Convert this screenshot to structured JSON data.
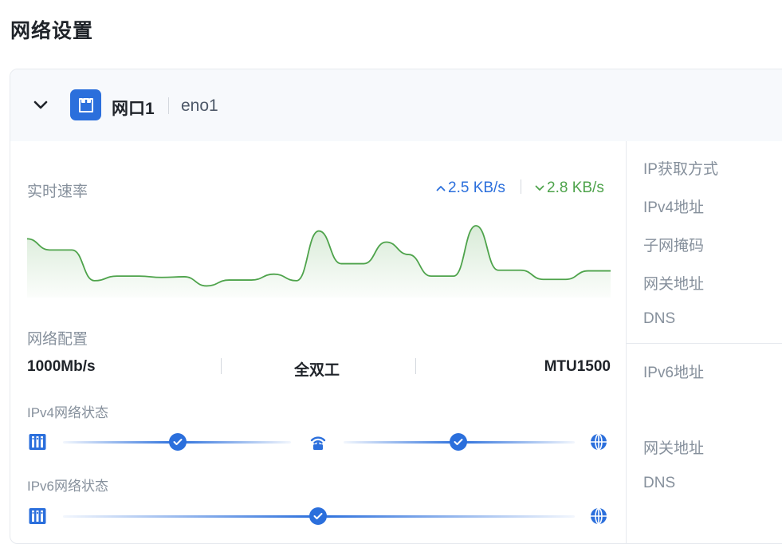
{
  "page": {
    "title": "网络设置"
  },
  "port": {
    "name": "网口1",
    "interface": "eno1"
  },
  "realtime": {
    "label": "实时速率",
    "upload": "2.5 KB/s",
    "download": "2.8 KB/s"
  },
  "traffic_series": {
    "color": "#4ea34b",
    "points": [
      0.8,
      0.63,
      0.63,
      0.16,
      0.23,
      0.23,
      0.21,
      0.22,
      0.08,
      0.17,
      0.17,
      0.26,
      0.16,
      0.92,
      0.42,
      0.42,
      0.75,
      0.56,
      0.23,
      0.23,
      1.0,
      0.32,
      0.32,
      0.18,
      0.18,
      0.31,
      0.31
    ]
  },
  "config": {
    "label": "网络配置",
    "speed": "1000Mb/s",
    "duplex": "全双工",
    "mtu": "MTU1500"
  },
  "ipv4_status": {
    "label": "IPv4网络状态"
  },
  "ipv6_status": {
    "label": "IPv6网络状态"
  },
  "details": {
    "ip_method": "IP获取方式",
    "ipv4_addr": "IPv4地址",
    "subnet": "子网掩码",
    "gateway": "网关地址",
    "dns": "DNS",
    "ipv6_addr": "IPv6地址",
    "ipv6_gateway": "网关地址",
    "ipv6_dns": "DNS"
  },
  "colors": {
    "accent": "#2b6fdc",
    "upload": "#2b6fdc",
    "download": "#4ea34b"
  }
}
